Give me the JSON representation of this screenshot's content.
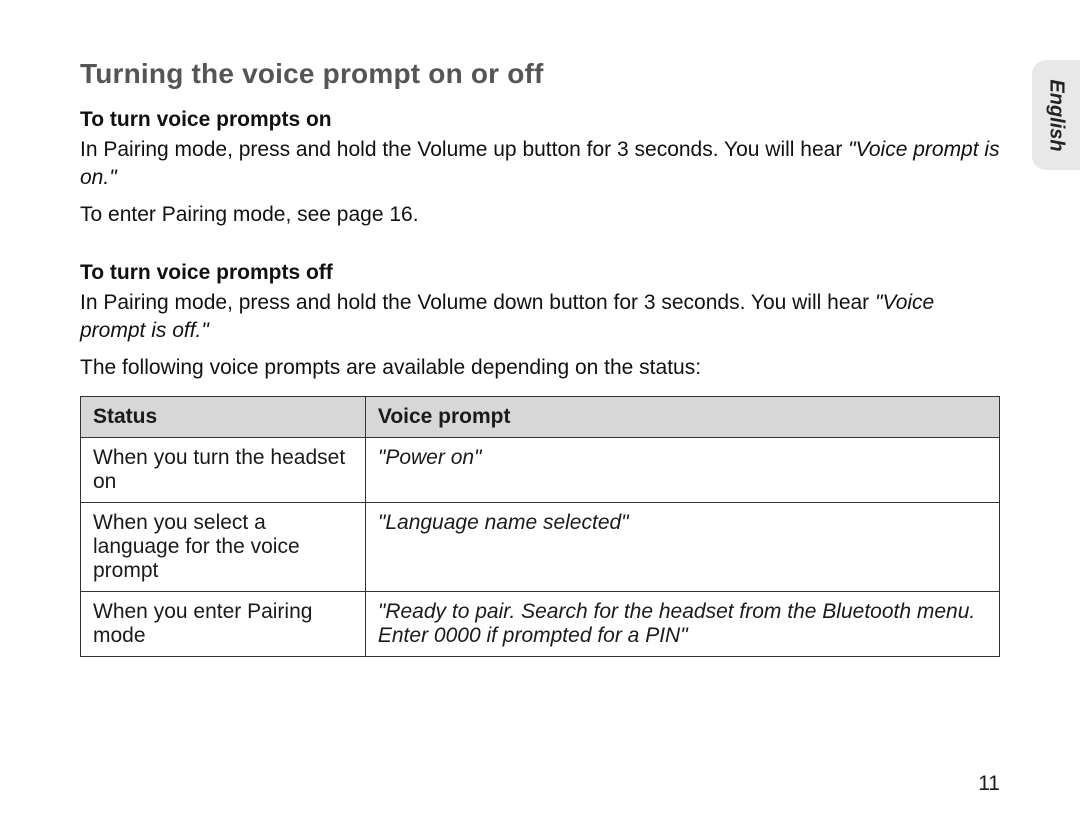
{
  "sideTab": {
    "label": "English"
  },
  "title": "Turning the voice prompt on or off",
  "section_on": {
    "heading": "To turn voice prompts on",
    "para1_pre": "In Pairing mode, press and hold the Volume up button for 3 seconds. You will hear ",
    "para1_quote": "\"Voice prompt is on.\"",
    "para2": "To enter Pairing mode, see page 16."
  },
  "section_off": {
    "heading": "To turn voice prompts off",
    "para1_pre": "In Pairing mode, press and hold the Volume down button for 3 seconds. You will hear ",
    "para1_quote": "\"Voice prompt is off.\"",
    "para2": "The following voice prompts are available depending on the status:"
  },
  "table": {
    "head_status": "Status",
    "head_prompt": "Voice prompt",
    "rows": [
      {
        "status": "When you turn the headset on",
        "prompt": "\"Power on\""
      },
      {
        "status": "When you select a language for the voice prompt",
        "prompt": "\"Language name  selected\""
      },
      {
        "status": "When you enter Pairing mode",
        "prompt": "\"Ready to pair. Search for the headset from the Bluetooth menu. Enter 0000 if prompted for a PIN\""
      }
    ]
  },
  "pageNumber": "11"
}
